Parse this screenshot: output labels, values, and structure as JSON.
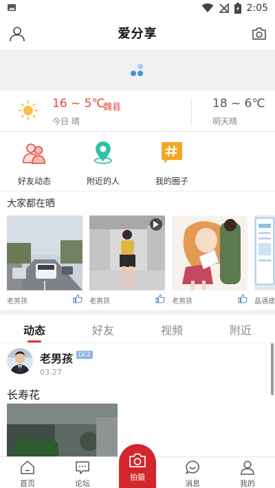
{
  "status_bar": {
    "time": "2:05",
    "icons": [
      "image-icon",
      "wifi-icon",
      "no-sim-icon",
      "battery-charging-icon"
    ]
  },
  "header": {
    "title": "爱分享",
    "left_icon": "user-icon",
    "right_icon": "camera-icon"
  },
  "weather": {
    "today_temp": "16 ~ 5℃",
    "city": "魏县",
    "today_desc": "今日 晴",
    "tomorrow_temp": "18 ~ 6℃",
    "tomorrow_desc": "明天晴",
    "icon": "sun-icon",
    "accent_color": "#e8453c"
  },
  "quick_nav": [
    {
      "label": "好友动态",
      "icon": "friends-icon"
    },
    {
      "label": "附近的人",
      "icon": "location-pin-icon"
    },
    {
      "label": "我的圈子",
      "icon": "hashtag-icon"
    }
  ],
  "share_section": {
    "title": "大家都在晒",
    "cards": [
      {
        "author": "老男孩",
        "icon": "thumbs-up-icon"
      },
      {
        "author": "老男孩",
        "icon": "thumbs-up-icon",
        "video": true
      },
      {
        "author": "老男孩",
        "icon": "thumbs-up-icon"
      },
      {
        "author": "晶通建",
        "icon": "thumbs-up-icon"
      }
    ]
  },
  "feed_tabs": [
    {
      "label": "动态",
      "active": true
    },
    {
      "label": "好友",
      "active": false
    },
    {
      "label": "视频",
      "active": false
    },
    {
      "label": "附近",
      "active": false
    }
  ],
  "post": {
    "author": "老男孩",
    "level": "LV.2",
    "date": "03-27",
    "title": "长寿花"
  },
  "bottom_nav": [
    {
      "label": "首页",
      "icon": "home-icon"
    },
    {
      "label": "论坛",
      "icon": "forum-icon"
    },
    {
      "label": "拍摄",
      "icon": "camera-icon"
    },
    {
      "label": "消息",
      "icon": "message-icon"
    },
    {
      "label": "我的",
      "icon": "profile-icon"
    }
  ],
  "colors": {
    "brand_red": "#d3262d",
    "tab_underline": "#d33",
    "level_badge": "#8fb4e3",
    "spinner": "#4a8fdc"
  }
}
